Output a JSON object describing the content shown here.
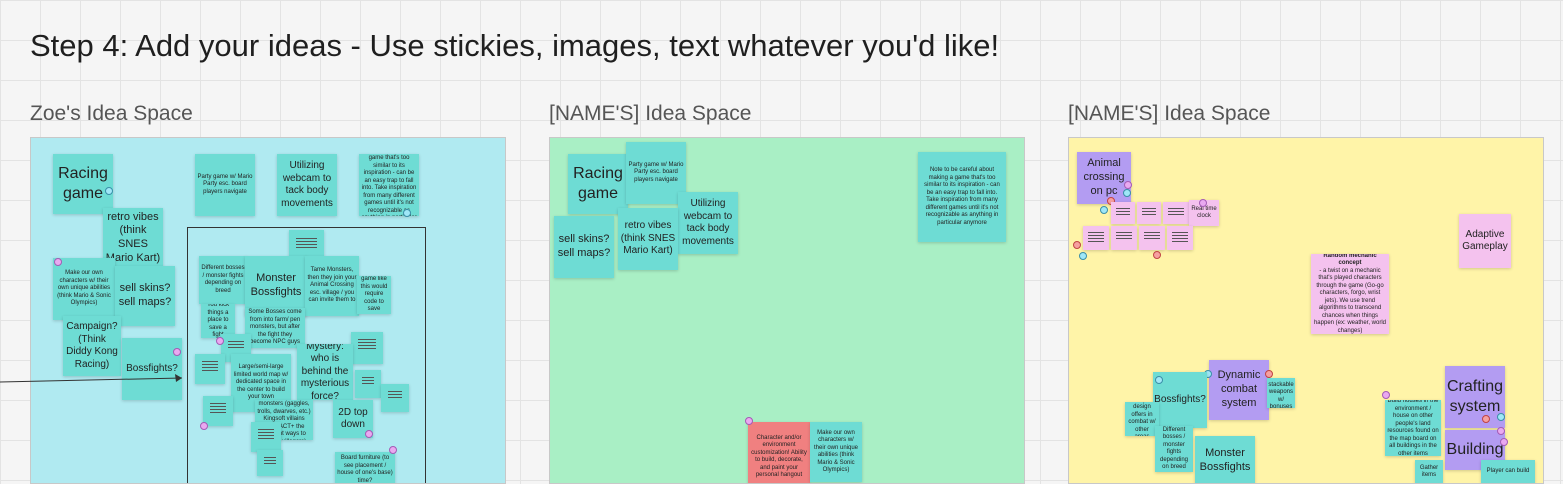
{
  "board": {
    "title": "Step 4: Add your ideas - Use stickies, images, text whatever you'd like!",
    "spaces": [
      {
        "label": "Zoe's Idea Space",
        "color": "#b0eaf1"
      },
      {
        "label": "[NAME'S] Idea Space",
        "color": "#a9efc5"
      },
      {
        "label": "[NAME'S] Idea Space",
        "color": "#fff4a8"
      }
    ]
  },
  "zoe": {
    "racing": "Racing game",
    "party": "Party game w/ Mario Party esc. board players navigate",
    "webcam": "Utilizing webcam to tack body movements",
    "note": "Note to be careful about making a game that's too similar to its inspiration - can be an easy trap to fall into. Take inspiration from many different games until it's not recognizable as anything in particular anymore",
    "retro": "retro vibes (think SNES Mario Kart)",
    "own_chars": "Make our own characters w/ their own unique abilities (think Mario & Sonic Olympics)",
    "skins": "sell skins? sell maps?",
    "campaign": "Campaign? (Think Diddy Kong Racing)",
    "bossfights": "Bossfights?",
    "diff_bosses": "Different bosses / monster fights depending on breed",
    "monster": "Monster Bossfights",
    "tame": "Tame Monsters, then they join your Animal Crossing esc. village / you can invite them to",
    "making": "Making a game like this would require code to save progress",
    "mystery": "Mystery: who is behind the mysterious force?",
    "small1": "You kick things a place to save a fight",
    "some": "Some Bosses come from into farm/ pen monsters, but after the fight they become NPC guys",
    "large": "Large/semi-large limited world map w/ dedicated space in the center to build your town",
    "villagers": "Villagers are monsters (gaggles, trolls, dwarves, etc.) Kingsoft villains (from ACT+ the different ways to display villagers)",
    "topdown": "2D top down",
    "board": "Board furniture (to see placement / house of one's base) time?"
  },
  "name1": {
    "racing": "Racing game",
    "party": "Party game w/ Mario Party esc. board players navigate",
    "webcam": "Utilizing webcam to tack body movements",
    "skins": "sell skins? sell maps?",
    "retro": "retro vibes (think SNES Mario Kart)",
    "note": "Note to be careful about making a game that's too similar to its inspiration - can be an easy trap to fall into. Take inspiration from many different games until it's not recognizable as anything in particular anymore",
    "character": "Character and/or environment customization! Ability to build, decorate, and paint your personal hangout",
    "own_chars": "Make our own characters w/ their own unique abilities (think Mario & Sonic Olympics)"
  },
  "name2": {
    "animal": "Animal crossing on pc",
    "real": "Real time clock",
    "adaptive": "Adaptive Gameplay",
    "random_title": "Random mechanic concept",
    "random_body": "- a twist on a mechanic that's played characters through the game (Go-go characters, forgo, wrist jets). We use trend algorithms to transcend chances when things happen (ex: weather, world changes)",
    "bossfights": "Bossfights?",
    "dynamic": "Dynamic combat system",
    "weapons": "Different stackable weapons w/ bonuses",
    "crafting": "Crafting system",
    "building": "Building",
    "build_text": "Build houses in the environment / house on other people's land resources found on the map board on all buildings in the other items",
    "monster": "Monster Bossfights",
    "different": "Different bosses / monster fights depending on breed",
    "weapon_design": "Weapon design offers in combat w/ other areas",
    "gather": "Gather items",
    "player": "Player can build"
  }
}
